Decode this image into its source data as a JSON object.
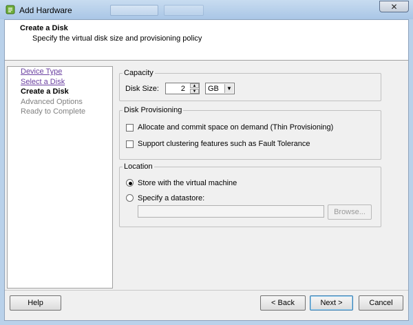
{
  "window": {
    "title": "Add Hardware",
    "close_glyph": "✕"
  },
  "header": {
    "title": "Create a Disk",
    "subtitle": "Specify the virtual disk size and provisioning policy"
  },
  "steps": [
    {
      "label": "Device Type",
      "state": "visited"
    },
    {
      "label": "Select a Disk",
      "state": "visited"
    },
    {
      "label": "Create a Disk",
      "state": "current"
    },
    {
      "label": "Advanced Options",
      "state": "pending"
    },
    {
      "label": "Ready to Complete",
      "state": "pending"
    }
  ],
  "capacity": {
    "legend": "Capacity",
    "disk_size_label": "Disk Size:",
    "disk_size_value": "2",
    "unit_value": "GB"
  },
  "provisioning": {
    "legend": "Disk Provisioning",
    "thin_label": "Allocate and commit space on demand (Thin Provisioning)",
    "thin_checked": false,
    "ft_label": "Support clustering features such as Fault Tolerance",
    "ft_checked": false
  },
  "location": {
    "legend": "Location",
    "store_with_vm_label": "Store with the virtual machine",
    "specify_datastore_label": "Specify a datastore:",
    "selected": "store_with_vm",
    "datastore_value": "",
    "browse_label": "Browse..."
  },
  "footer": {
    "help_label": "Help",
    "back_label": "< Back",
    "next_label": "Next >",
    "cancel_label": "Cancel"
  },
  "colors": {
    "title_bar": "#b9d1ea",
    "link": "#6a3fa0",
    "disabled_text": "#808080"
  },
  "icons": {
    "app": "vsphere-hardware-icon"
  }
}
